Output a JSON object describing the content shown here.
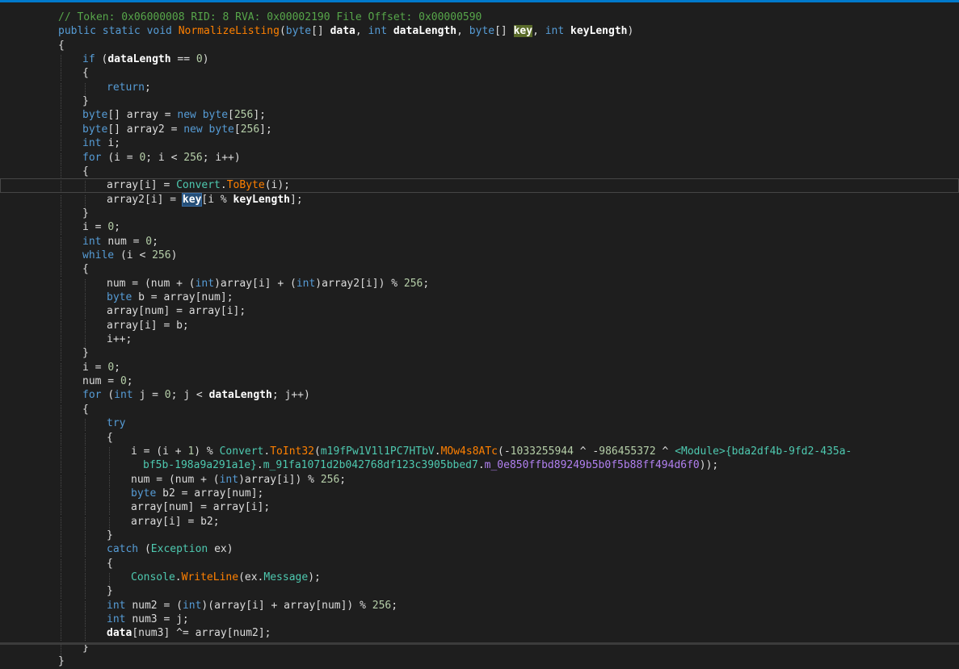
{
  "colors": {
    "background": "#1e1e1e",
    "accent": "#007acc",
    "comment": "#57a64a",
    "keyword": "#569cd6",
    "method": "#ff8000",
    "type": "#4ec9b0",
    "obfuscated_member": "#b180f0",
    "number": "#b5cea8",
    "plain": "#dcdcdc"
  },
  "editor": {
    "current_line_index": 12,
    "lines": [
      {
        "indent": 1,
        "tokens": [
          {
            "t": "// Token: 0x06000008 RID: 8 RVA: 0x00002190 File Offset: 0x00000590",
            "c": "comment"
          }
        ]
      },
      {
        "indent": 1,
        "tokens": [
          {
            "t": "public static void ",
            "c": "keyword"
          },
          {
            "t": "NormalizeListing",
            "c": "method"
          },
          {
            "t": "(",
            "c": "plain"
          },
          {
            "t": "byte",
            "c": "keyword"
          },
          {
            "t": "[] ",
            "c": "plain"
          },
          {
            "t": "data",
            "c": "param"
          },
          {
            "t": ", ",
            "c": "plain"
          },
          {
            "t": "int ",
            "c": "keyword"
          },
          {
            "t": "dataLength",
            "c": "param"
          },
          {
            "t": ", ",
            "c": "plain"
          },
          {
            "t": "byte",
            "c": "keyword"
          },
          {
            "t": "[] ",
            "c": "plain"
          },
          {
            "t": "key",
            "c": "param",
            "hl": "green"
          },
          {
            "t": ", ",
            "c": "plain"
          },
          {
            "t": "int ",
            "c": "keyword"
          },
          {
            "t": "keyLength",
            "c": "param"
          },
          {
            "t": ")",
            "c": "plain"
          }
        ]
      },
      {
        "indent": 1,
        "tokens": [
          {
            "t": "{",
            "c": "plain"
          }
        ]
      },
      {
        "indent": 2,
        "tokens": [
          {
            "t": "if ",
            "c": "keyword"
          },
          {
            "t": "(",
            "c": "plain"
          },
          {
            "t": "dataLength",
            "c": "param"
          },
          {
            "t": " == ",
            "c": "plain"
          },
          {
            "t": "0",
            "c": "number"
          },
          {
            "t": ")",
            "c": "plain"
          }
        ]
      },
      {
        "indent": 2,
        "tokens": [
          {
            "t": "{",
            "c": "plain"
          }
        ]
      },
      {
        "indent": 3,
        "tokens": [
          {
            "t": "return",
            "c": "keyword"
          },
          {
            "t": ";",
            "c": "plain"
          }
        ]
      },
      {
        "indent": 2,
        "tokens": [
          {
            "t": "}",
            "c": "plain"
          }
        ]
      },
      {
        "indent": 2,
        "tokens": [
          {
            "t": "byte",
            "c": "keyword"
          },
          {
            "t": "[] array = ",
            "c": "plain"
          },
          {
            "t": "new byte",
            "c": "keyword"
          },
          {
            "t": "[",
            "c": "plain"
          },
          {
            "t": "256",
            "c": "number"
          },
          {
            "t": "];",
            "c": "plain"
          }
        ]
      },
      {
        "indent": 2,
        "tokens": [
          {
            "t": "byte",
            "c": "keyword"
          },
          {
            "t": "[] array2 = ",
            "c": "plain"
          },
          {
            "t": "new byte",
            "c": "keyword"
          },
          {
            "t": "[",
            "c": "plain"
          },
          {
            "t": "256",
            "c": "number"
          },
          {
            "t": "];",
            "c": "plain"
          }
        ]
      },
      {
        "indent": 2,
        "tokens": [
          {
            "t": "int ",
            "c": "keyword"
          },
          {
            "t": "i;",
            "c": "plain"
          }
        ]
      },
      {
        "indent": 2,
        "tokens": [
          {
            "t": "for ",
            "c": "keyword"
          },
          {
            "t": "(i = ",
            "c": "plain"
          },
          {
            "t": "0",
            "c": "number"
          },
          {
            "t": "; i < ",
            "c": "plain"
          },
          {
            "t": "256",
            "c": "number"
          },
          {
            "t": "; i++)",
            "c": "plain"
          }
        ]
      },
      {
        "indent": 2,
        "tokens": [
          {
            "t": "{",
            "c": "plain"
          }
        ]
      },
      {
        "indent": 3,
        "tokens": [
          {
            "t": "array[i] = ",
            "c": "plain"
          },
          {
            "t": "Convert",
            "c": "type"
          },
          {
            "t": ".",
            "c": "plain"
          },
          {
            "t": "ToByte",
            "c": "method"
          },
          {
            "t": "(i);",
            "c": "plain"
          }
        ]
      },
      {
        "indent": 3,
        "tokens": [
          {
            "t": "array2[i] = ",
            "c": "plain"
          },
          {
            "t": "key",
            "c": "param",
            "hl": "blue"
          },
          {
            "t": "[i % ",
            "c": "plain"
          },
          {
            "t": "keyLength",
            "c": "param"
          },
          {
            "t": "];",
            "c": "plain"
          }
        ]
      },
      {
        "indent": 2,
        "tokens": [
          {
            "t": "}",
            "c": "plain"
          }
        ]
      },
      {
        "indent": 2,
        "tokens": [
          {
            "t": "i = ",
            "c": "plain"
          },
          {
            "t": "0",
            "c": "number"
          },
          {
            "t": ";",
            "c": "plain"
          }
        ]
      },
      {
        "indent": 2,
        "tokens": [
          {
            "t": "int ",
            "c": "keyword"
          },
          {
            "t": "num = ",
            "c": "plain"
          },
          {
            "t": "0",
            "c": "number"
          },
          {
            "t": ";",
            "c": "plain"
          }
        ]
      },
      {
        "indent": 2,
        "tokens": [
          {
            "t": "while ",
            "c": "keyword"
          },
          {
            "t": "(i < ",
            "c": "plain"
          },
          {
            "t": "256",
            "c": "number"
          },
          {
            "t": ")",
            "c": "plain"
          }
        ]
      },
      {
        "indent": 2,
        "tokens": [
          {
            "t": "{",
            "c": "plain"
          }
        ]
      },
      {
        "indent": 3,
        "tokens": [
          {
            "t": "num = (num + (",
            "c": "plain"
          },
          {
            "t": "int",
            "c": "keyword"
          },
          {
            "t": ")array[i] + (",
            "c": "plain"
          },
          {
            "t": "int",
            "c": "keyword"
          },
          {
            "t": ")array2[i]) % ",
            "c": "plain"
          },
          {
            "t": "256",
            "c": "number"
          },
          {
            "t": ";",
            "c": "plain"
          }
        ]
      },
      {
        "indent": 3,
        "tokens": [
          {
            "t": "byte ",
            "c": "keyword"
          },
          {
            "t": "b = array[num];",
            "c": "plain"
          }
        ]
      },
      {
        "indent": 3,
        "tokens": [
          {
            "t": "array[num] = array[i];",
            "c": "plain"
          }
        ]
      },
      {
        "indent": 3,
        "tokens": [
          {
            "t": "array[i] = b;",
            "c": "plain"
          }
        ]
      },
      {
        "indent": 3,
        "tokens": [
          {
            "t": "i++;",
            "c": "plain"
          }
        ]
      },
      {
        "indent": 2,
        "tokens": [
          {
            "t": "}",
            "c": "plain"
          }
        ]
      },
      {
        "indent": 2,
        "tokens": [
          {
            "t": "i = ",
            "c": "plain"
          },
          {
            "t": "0",
            "c": "number"
          },
          {
            "t": ";",
            "c": "plain"
          }
        ]
      },
      {
        "indent": 2,
        "tokens": [
          {
            "t": "num = ",
            "c": "plain"
          },
          {
            "t": "0",
            "c": "number"
          },
          {
            "t": ";",
            "c": "plain"
          }
        ]
      },
      {
        "indent": 2,
        "tokens": [
          {
            "t": "for ",
            "c": "keyword"
          },
          {
            "t": "(",
            "c": "plain"
          },
          {
            "t": "int ",
            "c": "keyword"
          },
          {
            "t": "j = ",
            "c": "plain"
          },
          {
            "t": "0",
            "c": "number"
          },
          {
            "t": "; j < ",
            "c": "plain"
          },
          {
            "t": "dataLength",
            "c": "param"
          },
          {
            "t": "; j++)",
            "c": "plain"
          }
        ]
      },
      {
        "indent": 2,
        "tokens": [
          {
            "t": "{",
            "c": "plain"
          }
        ]
      },
      {
        "indent": 3,
        "tokens": [
          {
            "t": "try",
            "c": "keyword"
          }
        ]
      },
      {
        "indent": 3,
        "tokens": [
          {
            "t": "{",
            "c": "plain"
          }
        ]
      },
      {
        "indent": 4,
        "tokens": [
          {
            "t": "i = (i + ",
            "c": "plain"
          },
          {
            "t": "1",
            "c": "number"
          },
          {
            "t": ") % ",
            "c": "plain"
          },
          {
            "t": "Convert",
            "c": "type"
          },
          {
            "t": ".",
            "c": "plain"
          },
          {
            "t": "ToInt32",
            "c": "method"
          },
          {
            "t": "(",
            "c": "plain"
          },
          {
            "t": "m19fPw1V1l1PC7HTbV",
            "c": "type"
          },
          {
            "t": ".",
            "c": "plain"
          },
          {
            "t": "MOw4s8ATc",
            "c": "method"
          },
          {
            "t": "(-",
            "c": "plain"
          },
          {
            "t": "1033255944",
            "c": "number"
          },
          {
            "t": " ^ -",
            "c": "plain"
          },
          {
            "t": "986455372",
            "c": "number"
          },
          {
            "t": " ^ ",
            "c": "plain"
          },
          {
            "t": "<Module>{bda2df4b-9fd2-435a-",
            "c": "type"
          }
        ]
      },
      {
        "indent": 4,
        "extra": 15,
        "tokens": [
          {
            "t": "bf5b-198a9a291a1e}",
            "c": "type"
          },
          {
            "t": ".",
            "c": "plain"
          },
          {
            "t": "m_91fa1071d2b042768df123c3905bbed7",
            "c": "member"
          },
          {
            "t": ".",
            "c": "plain"
          },
          {
            "t": "m_0e850ffbd89249b5b0f5b88ff494d6f0",
            "c": "obf-member"
          },
          {
            "t": "));",
            "c": "plain"
          }
        ]
      },
      {
        "indent": 4,
        "tokens": [
          {
            "t": "num = (num + (",
            "c": "plain"
          },
          {
            "t": "int",
            "c": "keyword"
          },
          {
            "t": ")array[i]) % ",
            "c": "plain"
          },
          {
            "t": "256",
            "c": "number"
          },
          {
            "t": ";",
            "c": "plain"
          }
        ]
      },
      {
        "indent": 4,
        "tokens": [
          {
            "t": "byte ",
            "c": "keyword"
          },
          {
            "t": "b2 = array[num];",
            "c": "plain"
          }
        ]
      },
      {
        "indent": 4,
        "tokens": [
          {
            "t": "array[num] = array[i];",
            "c": "plain"
          }
        ]
      },
      {
        "indent": 4,
        "tokens": [
          {
            "t": "array[i] = b2;",
            "c": "plain"
          }
        ]
      },
      {
        "indent": 3,
        "tokens": [
          {
            "t": "}",
            "c": "plain"
          }
        ]
      },
      {
        "indent": 3,
        "tokens": [
          {
            "t": "catch ",
            "c": "keyword"
          },
          {
            "t": "(",
            "c": "plain"
          },
          {
            "t": "Exception ",
            "c": "type"
          },
          {
            "t": "ex)",
            "c": "plain"
          }
        ]
      },
      {
        "indent": 3,
        "tokens": [
          {
            "t": "{",
            "c": "plain"
          }
        ]
      },
      {
        "indent": 4,
        "tokens": [
          {
            "t": "Console",
            "c": "type"
          },
          {
            "t": ".",
            "c": "plain"
          },
          {
            "t": "WriteLine",
            "c": "method"
          },
          {
            "t": "(ex.",
            "c": "plain"
          },
          {
            "t": "Message",
            "c": "member"
          },
          {
            "t": ");",
            "c": "plain"
          }
        ]
      },
      {
        "indent": 3,
        "tokens": [
          {
            "t": "}",
            "c": "plain"
          }
        ]
      },
      {
        "indent": 3,
        "tokens": [
          {
            "t": "int ",
            "c": "keyword"
          },
          {
            "t": "num2 = (",
            "c": "plain"
          },
          {
            "t": "int",
            "c": "keyword"
          },
          {
            "t": ")(array[i] + array[num]) % ",
            "c": "plain"
          },
          {
            "t": "256",
            "c": "number"
          },
          {
            "t": ";",
            "c": "plain"
          }
        ]
      },
      {
        "indent": 3,
        "tokens": [
          {
            "t": "int ",
            "c": "keyword"
          },
          {
            "t": "num3 = j;",
            "c": "plain"
          }
        ]
      },
      {
        "indent": 3,
        "tokens": [
          {
            "t": "data",
            "c": "param"
          },
          {
            "t": "[num3] ^= array[num2];",
            "c": "plain"
          }
        ]
      },
      {
        "indent": 2,
        "tokens": [
          {
            "t": "}",
            "c": "plain"
          }
        ]
      },
      {
        "indent": 1,
        "tokens": [
          {
            "t": "}",
            "c": "plain"
          }
        ]
      }
    ]
  }
}
